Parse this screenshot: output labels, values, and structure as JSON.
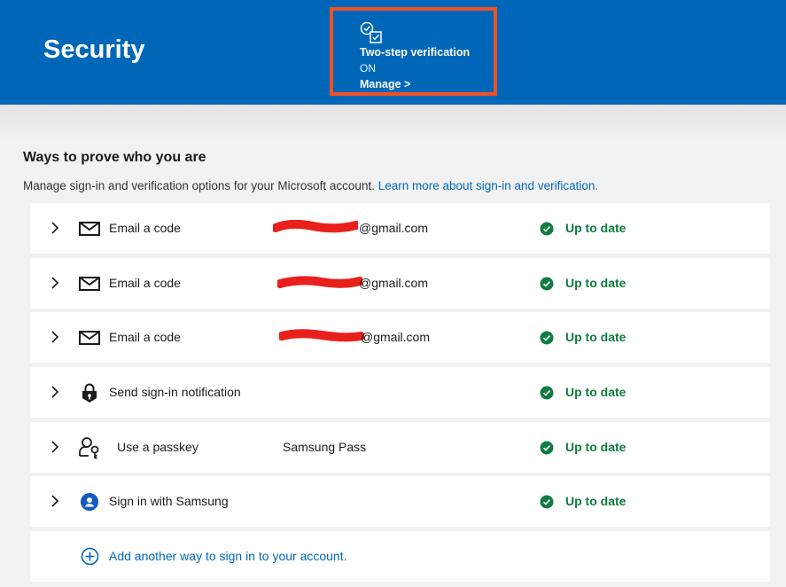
{
  "header": {
    "title": "Security"
  },
  "two_step": {
    "title": "Two-step verification",
    "status": "ON",
    "manage_label": "Manage >"
  },
  "section": {
    "title": "Ways to prove who you are",
    "description": "Manage sign-in and verification options for your Microsoft account. ",
    "learn_more_link": "Learn more about sign-in and verification."
  },
  "methods": [
    {
      "label": "Email a code",
      "detail": "@gmail.com",
      "status": "Up to date",
      "icon": "email-icon"
    },
    {
      "label": "Email a code",
      "detail": "@gmail.com",
      "status": "Up to date",
      "icon": "email-icon"
    },
    {
      "label": "Email a code",
      "detail": "@gmail.com",
      "status": "Up to date",
      "icon": "email-icon"
    },
    {
      "label": "Send sign-in notification",
      "detail": "",
      "status": "Up to date",
      "icon": "lock-icon"
    },
    {
      "label": "Use a passkey",
      "detail": "Samsung Pass",
      "status": "Up to date",
      "icon": "passkey-icon"
    },
    {
      "label": "Sign in with Samsung",
      "detail": "",
      "status": "Up to date",
      "icon": "samsung-account-icon"
    }
  ],
  "add_method": {
    "label": "Add another way to sign in to your account."
  },
  "colors": {
    "header_bg": "#0067b8",
    "highlight_border": "#f25022",
    "status_green": "#107c41",
    "link_blue": "#0067b8"
  }
}
